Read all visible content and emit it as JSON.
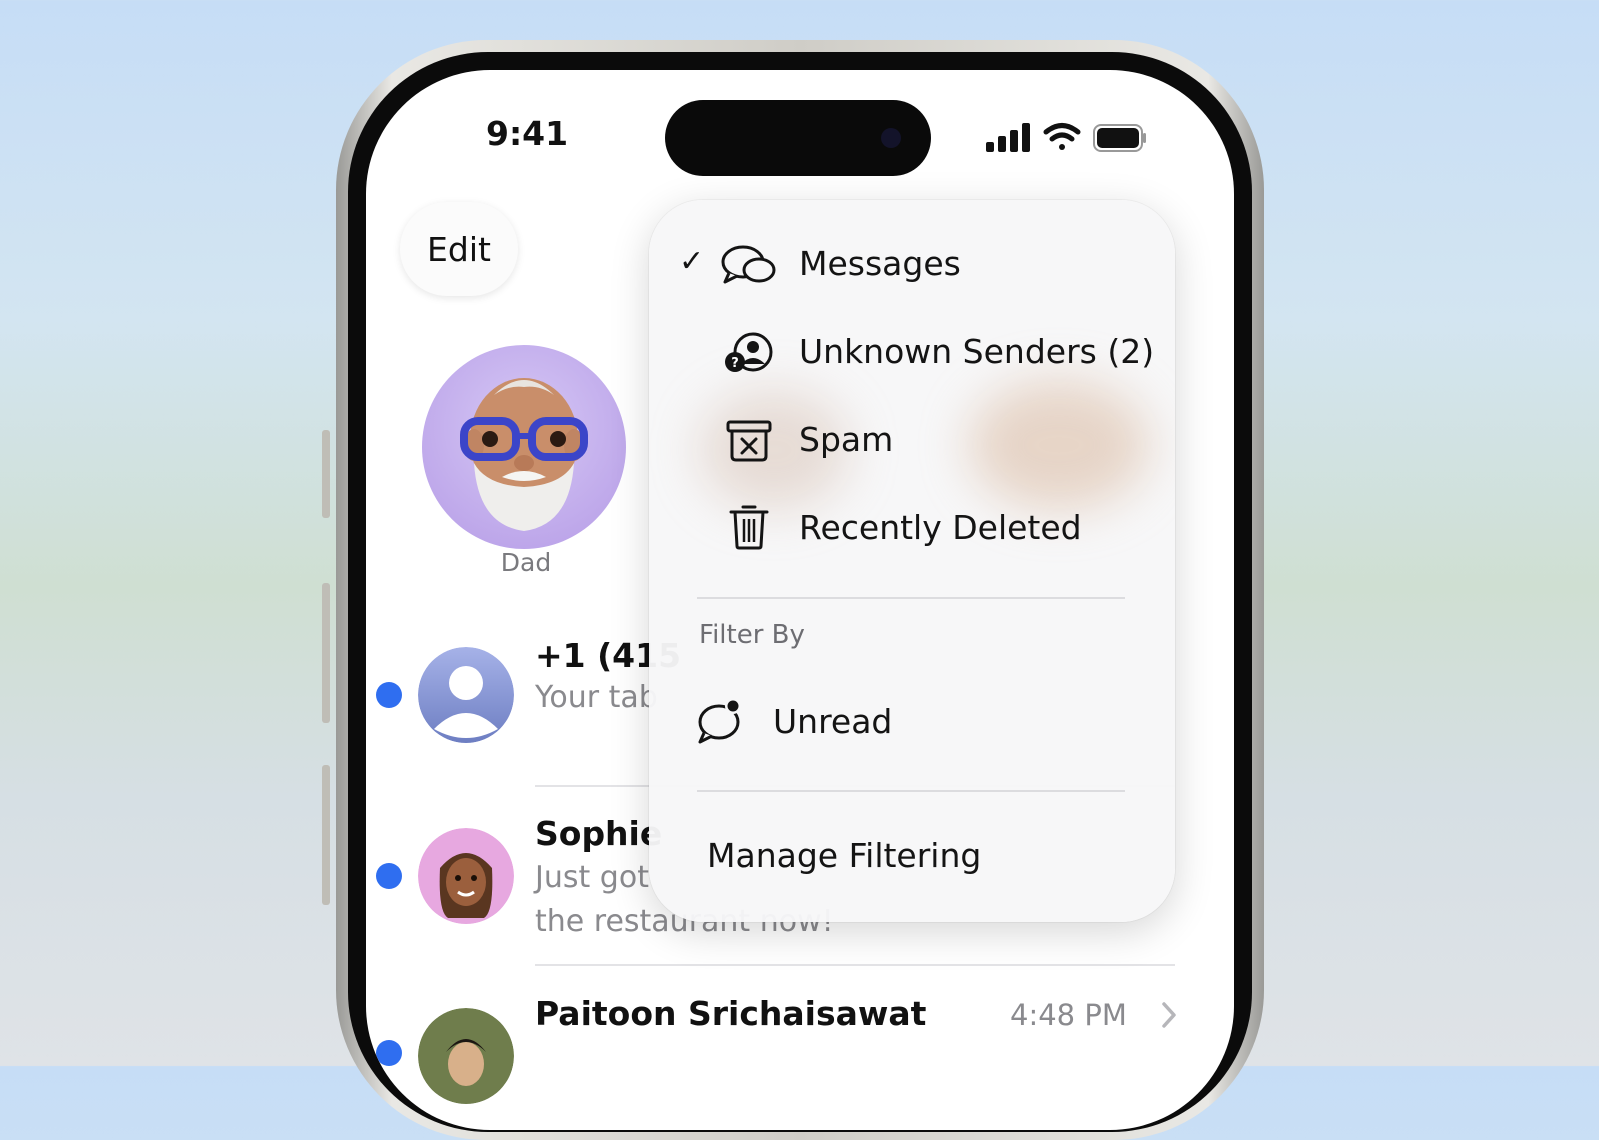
{
  "status_bar": {
    "time": "9:41"
  },
  "header": {
    "edit_label": "Edit"
  },
  "pinned": [
    {
      "name": "Dad"
    }
  ],
  "conversations": [
    {
      "title": "+1 (415",
      "preview": "Your tab",
      "unread": true
    },
    {
      "title": "Sophie",
      "preview_line1": "Just got",
      "preview_line2": "the restaurant now!",
      "unread": true
    },
    {
      "title": "Paitoon Srichaisawat",
      "time": "4:48 PM",
      "unread": true
    }
  ],
  "menu": {
    "items": [
      {
        "label": "Messages",
        "icon": "speech-bubbles-icon",
        "checked": true
      },
      {
        "label": "Unknown Senders (2)",
        "icon": "unknown-person-icon",
        "checked": false
      },
      {
        "label": "Spam",
        "icon": "spam-xmark-bin-icon",
        "checked": false
      },
      {
        "label": "Recently Deleted",
        "icon": "trash-icon",
        "checked": false
      }
    ],
    "filter_section_label": "Filter By",
    "filter_items": [
      {
        "label": "Unread",
        "icon": "unread-bubble-icon"
      }
    ],
    "manage_label": "Manage Filtering"
  },
  "colors": {
    "accent": "#2f6ef0",
    "menu_bg": "#f7f7f8"
  }
}
